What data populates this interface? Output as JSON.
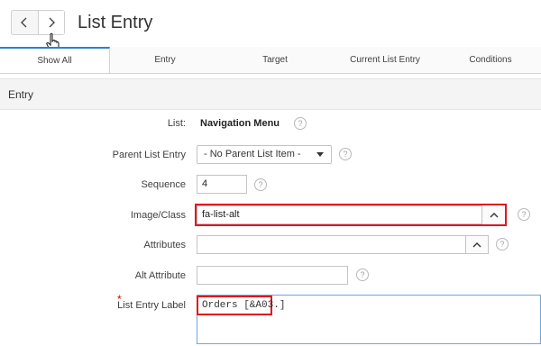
{
  "header": {
    "title": "List Entry",
    "back_icon": "chevron-left-icon",
    "forward_icon": "chevron-right-icon"
  },
  "tabs": [
    {
      "label": "Show All",
      "active": true
    },
    {
      "label": "Entry"
    },
    {
      "label": "Target"
    },
    {
      "label": "Current List Entry"
    },
    {
      "label": "Conditions"
    }
  ],
  "section": {
    "title": "Entry"
  },
  "form": {
    "list": {
      "label": "List:",
      "value": "Navigation Menu"
    },
    "parent_list_entry": {
      "label": "Parent List Entry",
      "value": "- No Parent List Item -"
    },
    "sequence": {
      "label": "Sequence",
      "value": "4"
    },
    "image_class": {
      "label": "Image/Class",
      "value": "fa-list-alt"
    },
    "attributes": {
      "label": "Attributes",
      "value": ""
    },
    "alt_attribute": {
      "label": "Alt Attribute",
      "value": ""
    },
    "list_entry_label": {
      "label": "List Entry Label",
      "value": "Orders [&A03.]",
      "required_mark": "*"
    }
  },
  "help_glyph": "?",
  "colors": {
    "accent": "#2b7fd4",
    "highlight": "#e0141e",
    "required": "#d00000"
  }
}
